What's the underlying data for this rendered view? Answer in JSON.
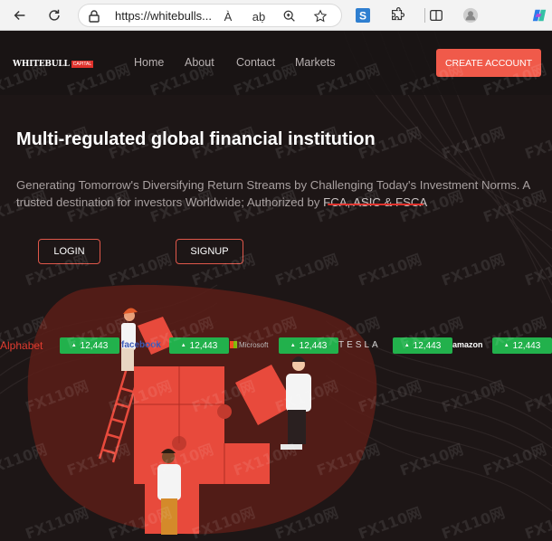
{
  "browser": {
    "url": "https://whitebulls...",
    "icons": [
      "back-icon",
      "refresh-icon",
      "lock-icon",
      "read-aloud-icon",
      "translate-icon",
      "zoom-icon",
      "favorite-icon",
      "s-extension-icon",
      "extensions-icon",
      "split-screen-icon",
      "profile-icon",
      "copilot-icon"
    ],
    "read_aloud_label": "À",
    "translate_label": "aḅ"
  },
  "site": {
    "logo_text": "WHITEBULL",
    "logo_badge": "CAPITAL",
    "nav": [
      "Home",
      "About",
      "Contact",
      "Markets"
    ],
    "cta": "CREATE ACCOUNT",
    "headline": "Multi-regulated global financial institution",
    "subtext_before": "Generating Tomorrow's Diversifying Return Streams by Challenging Today's Investment Norms. A trusted destination for investors Worldwide; Authorized by ",
    "subtext_regulators": "FCA, ASIC & FSCA",
    "login": "LOGIN",
    "signup": "SIGNUP"
  },
  "ticker": [
    {
      "logo": "Alphabet",
      "value": "12,443"
    },
    {
      "logo": "facebook",
      "value": "12,443"
    },
    {
      "logo": "Microsoft",
      "value": "12,443"
    },
    {
      "logo": "TESLA",
      "value": "12,443"
    },
    {
      "logo": "amazon",
      "value": "12,443"
    }
  ],
  "watermark": "FX110网",
  "colors": {
    "accent": "#f05a4a",
    "ticker_green": "#22b14c",
    "underline": "#e0322c",
    "puzzle": "#e84a3c"
  }
}
